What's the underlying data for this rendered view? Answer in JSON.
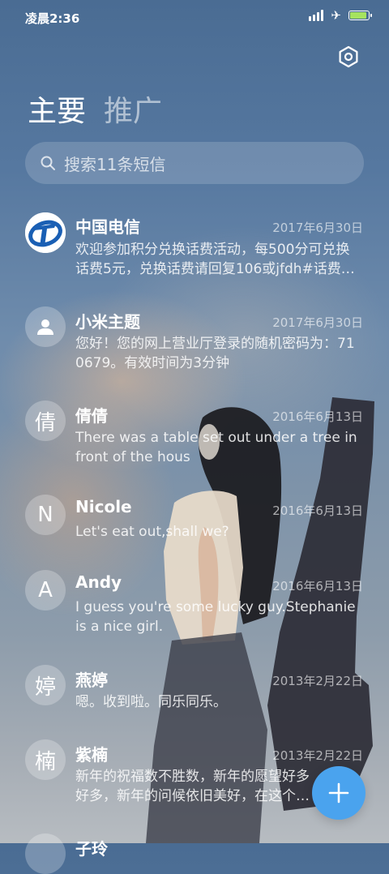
{
  "status": {
    "time": "凌晨2:36"
  },
  "tabs": {
    "main": "主要",
    "promo": "推广"
  },
  "search": {
    "placeholder": "搜索11条短信"
  },
  "messages": [
    {
      "name": "中国电信",
      "date": "2017年6月30日",
      "preview": "欢迎参加积分兑换话费活动，每500分可兑换话费5元，兑换话费请回复106或jfdh#话费兑换",
      "avatar": "china-telecom-logo"
    },
    {
      "name": "小米主题",
      "date": "2017年6月30日",
      "preview": "您好！您的网上营业厅登录的随机密码为：710679。有效时间为3分钟",
      "avatar": "person-icon"
    },
    {
      "name": "倩倩",
      "date": "2016年6月13日",
      "preview": "There was a table set out under a tree in front of the hous",
      "avatar_char": "倩"
    },
    {
      "name": "Nicole",
      "date": "2016年6月13日",
      "preview": "Let's eat out,shall we?",
      "avatar_char": "N"
    },
    {
      "name": "Andy",
      "date": "2016年6月13日",
      "preview": "I guess you're some lucky guy.Stephanie is a nice girl.",
      "avatar_char": "A"
    },
    {
      "name": "燕婷",
      "date": "2013年2月22日",
      "preview": "嗯。收到啦。同乐同乐。",
      "avatar_char": "婷"
    },
    {
      "name": "紫楠",
      "date": "2013年2月22日",
      "preview": "新年的祝福数不胜数，新年的愿望好多好多，新年的问候依旧美好，在这个温馨的时刻",
      "avatar_char": "楠"
    },
    {
      "name": "子玲",
      "date": "",
      "preview": "",
      "avatar_char": ""
    }
  ],
  "colors": {
    "fab": "#4aa3ee",
    "telecom_blue": "#1a5fb4",
    "battery": "#a6e35e"
  },
  "icons": {
    "settings": "gear-icon",
    "search": "search-icon",
    "compose": "plus-icon"
  }
}
